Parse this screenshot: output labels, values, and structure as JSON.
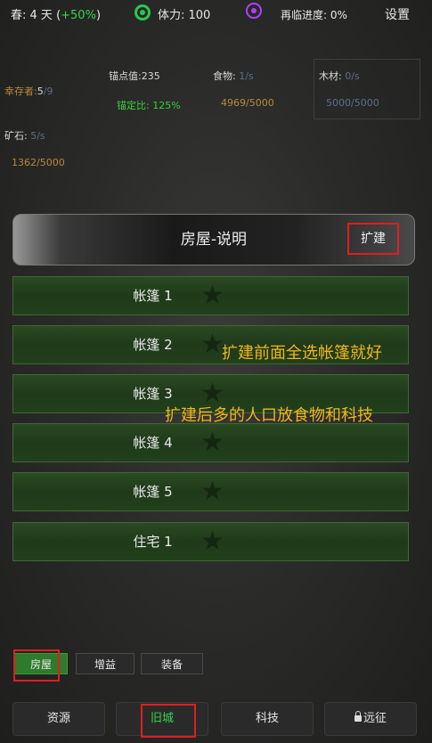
{
  "topbar": {
    "season_day": "春: 4 天",
    "bonus_open": "(",
    "bonus": "+50%",
    "bonus_close": ")",
    "stamina": "体力: 100",
    "revisit": "再临进度: 0%",
    "settings": "设置"
  },
  "stats": {
    "survivors_label": "幸存者:",
    "survivors_value": "5",
    "survivors_max": "/9",
    "anchor": "锚点值:235",
    "anchor_ratio": "锚定比: 125%",
    "food_label": "食物:",
    "food_rate": "1/s",
    "food_amount": "4969/5000",
    "wood_label": "木材:",
    "wood_rate": "0/s",
    "wood_amount": "5000/5000",
    "ore_label": "矿石:",
    "ore_rate": "5/s",
    "ore_amount": "1362/5000"
  },
  "header": {
    "title": "房屋-说明",
    "expand": "扩建"
  },
  "rows": [
    "帐篷 1",
    "帐篷 2",
    "帐篷 3",
    "帐篷 4",
    "帐篷 5",
    "住宅 1"
  ],
  "notes": {
    "line1": "扩建前面全选帐篷就好",
    "line2": "扩建后多的人口放食物和科技"
  },
  "subtabs": [
    "房屋",
    "增益",
    "装备"
  ],
  "nav": {
    "resources": "资源",
    "old_city": "旧城",
    "tech": "科技",
    "expedition": "远征"
  },
  "colors": {
    "accent_green": "#37d64a",
    "highlight_red": "#e01e1e",
    "note_gold": "#f2b51c"
  }
}
